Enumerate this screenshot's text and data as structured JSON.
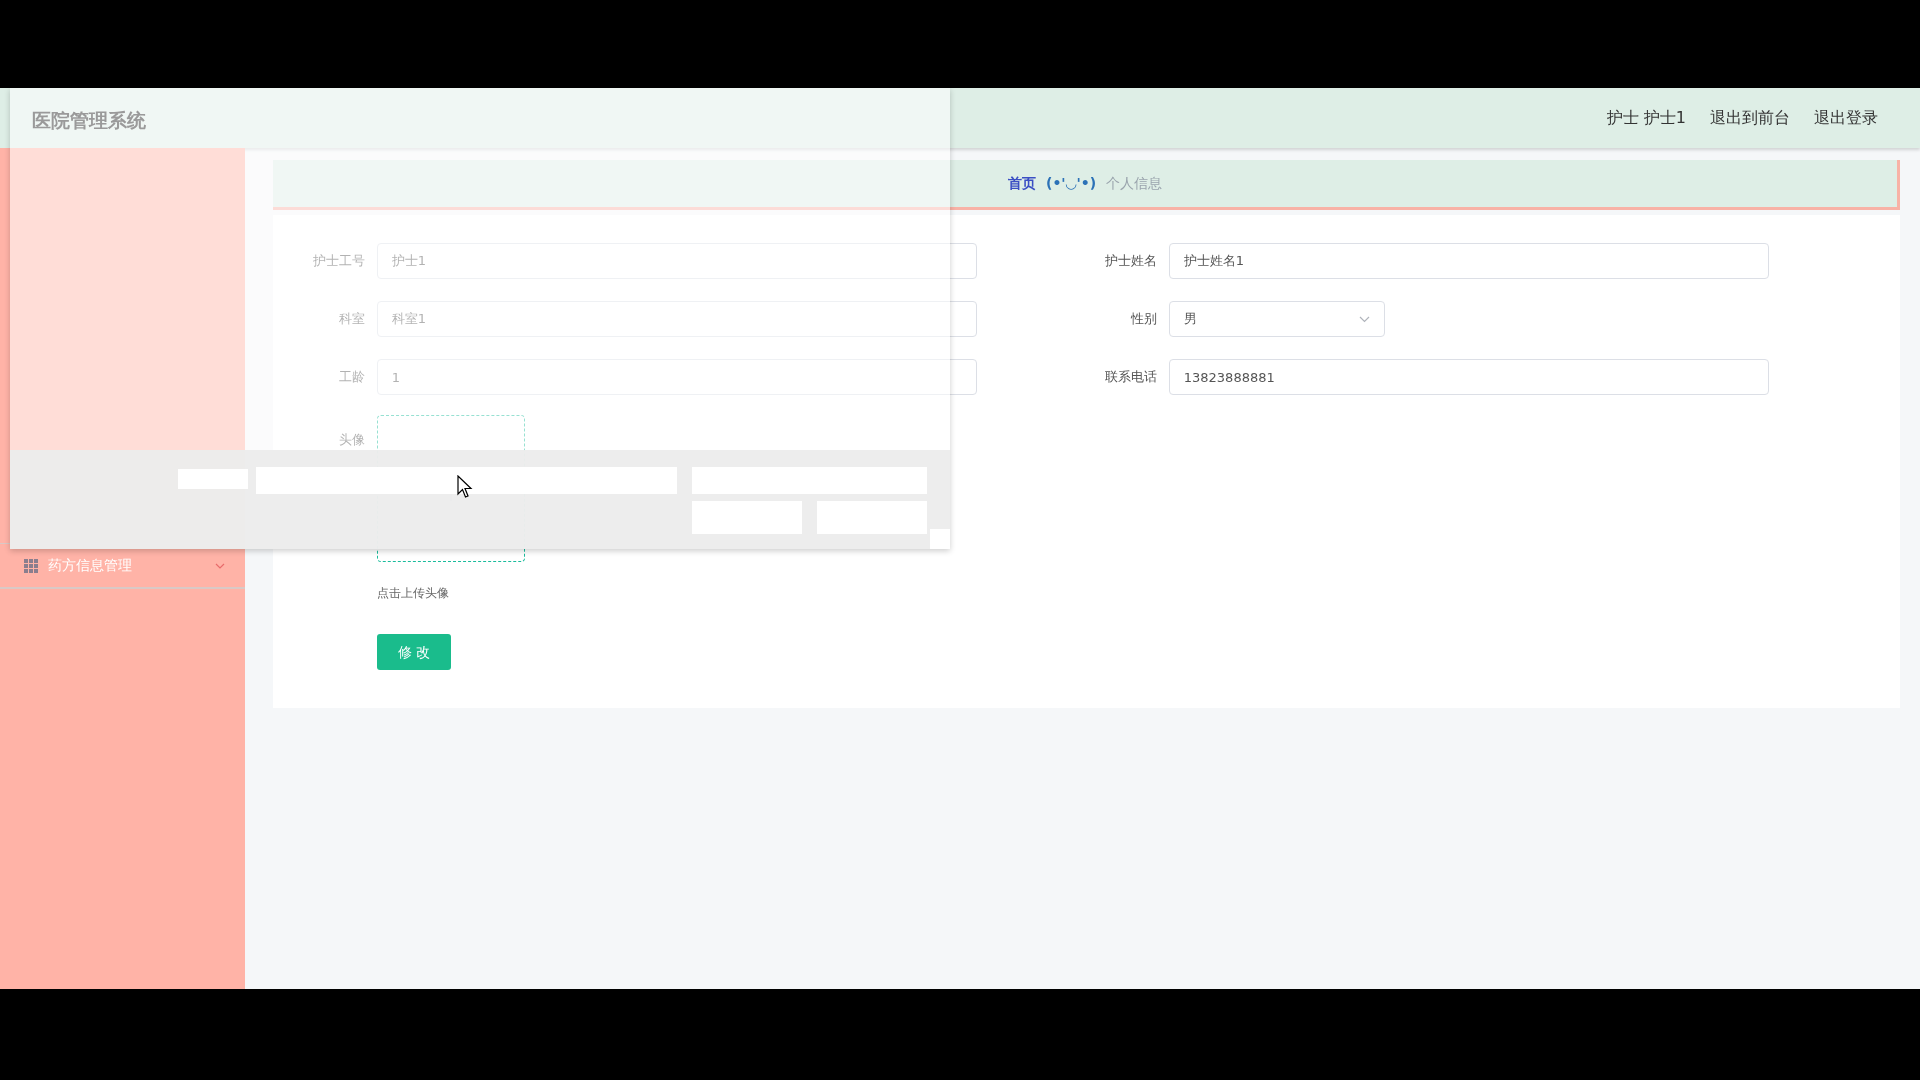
{
  "app_title": "医院管理系统",
  "header_links": [
    "护士 护士1",
    "退出到前台",
    "退出登录"
  ],
  "sidebar": {
    "items": [
      {
        "label": "药方信息管理",
        "expanded": false
      }
    ]
  },
  "breadcrumb": {
    "home": "首页",
    "separator": "(•'◡'•)",
    "current": "个人信息"
  },
  "form": {
    "fields": [
      {
        "label": "护士工号",
        "value": "护士1",
        "kind": "input"
      },
      {
        "label": "护士姓名",
        "value": "护士姓名1",
        "kind": "input"
      },
      {
        "label": "科室",
        "value": "科室1",
        "kind": "input"
      },
      {
        "label": "性别",
        "value": "男",
        "kind": "select"
      },
      {
        "label": "工龄",
        "value": "1",
        "kind": "input"
      },
      {
        "label": "联系电话",
        "value": "13823888881",
        "kind": "input"
      }
    ],
    "avatar": {
      "label": "头像",
      "hint": "点击上传头像"
    },
    "submit": "修 改"
  }
}
